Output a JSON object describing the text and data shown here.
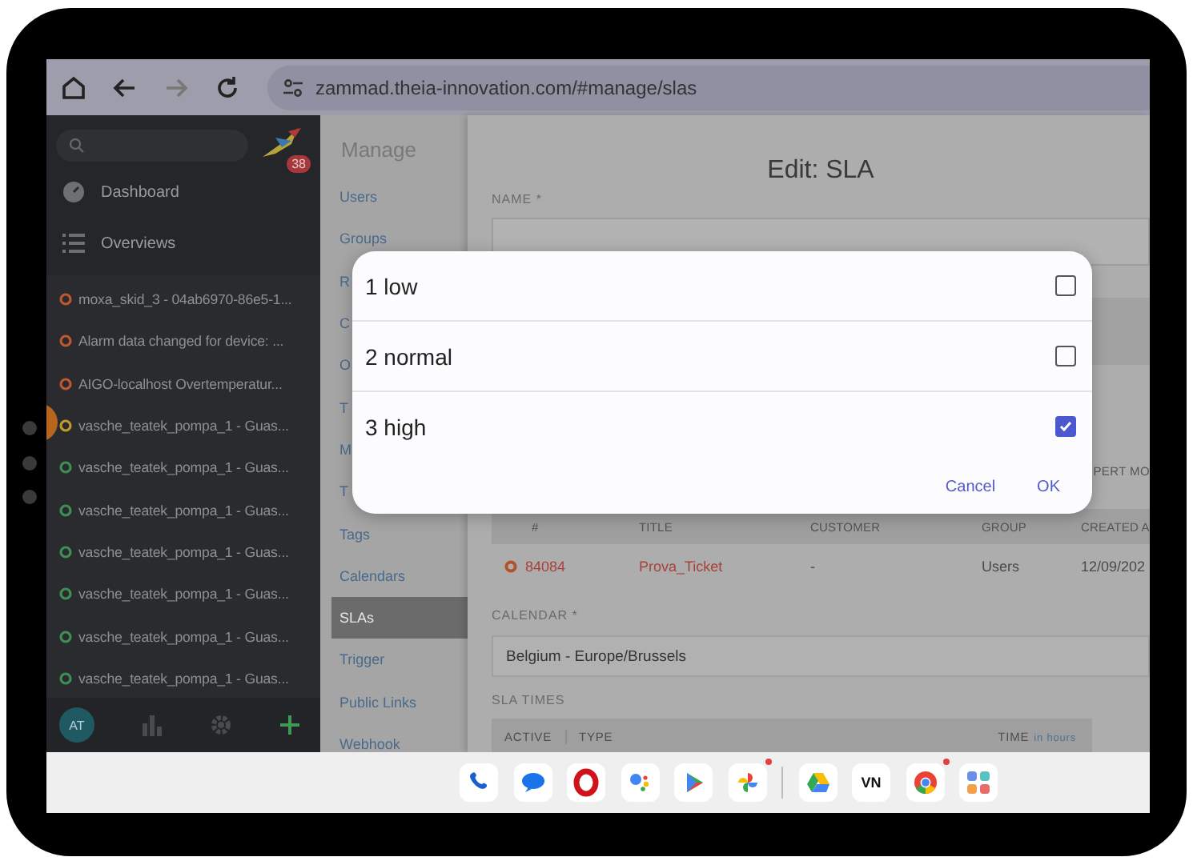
{
  "browser": {
    "url": "zammad.theia-innovation.com/#manage/slas"
  },
  "sidebar": {
    "notification_count": "38",
    "nav": [
      {
        "kind": "dashboard",
        "label": "Dashboard"
      },
      {
        "kind": "overviews",
        "label": "Overviews"
      }
    ],
    "tickets": [
      {
        "title": "moxa_skid_3 - 04ab6970-86e5-1...",
        "color": "#c2562c"
      },
      {
        "title": "Alarm data changed for device: ...",
        "color": "#c2562c"
      },
      {
        "title": "AIGO-localhost Overtemperatur...",
        "color": "#c2562c"
      },
      {
        "title": "vasche_teatek_pompa_1 - Guas...",
        "color": "#c29a2c"
      },
      {
        "title": "vasche_teatek_pompa_1 - Guas...",
        "color": "#3f8f55"
      },
      {
        "title": "vasche_teatek_pompa_1 - Guas...",
        "color": "#3f8f55"
      },
      {
        "title": "vasche_teatek_pompa_1 - Guas...",
        "color": "#3f8f55"
      },
      {
        "title": "vasche_teatek_pompa_1 - Guas...",
        "color": "#3f8f55"
      },
      {
        "title": "vasche_teatek_pompa_1 - Guas...",
        "color": "#3f8f55"
      },
      {
        "title": "vasche_teatek_pompa_1 - Guas...",
        "color": "#3f8f55"
      }
    ],
    "avatar": "AT"
  },
  "manage": {
    "title": "Manage",
    "items": [
      {
        "label": "Users",
        "selected": false
      },
      {
        "label": "Groups",
        "selected": false
      },
      {
        "label": "R",
        "selected": false
      },
      {
        "label": "C",
        "selected": false
      },
      {
        "label": "O",
        "selected": false
      },
      {
        "label": "T",
        "selected": false
      },
      {
        "label": "M",
        "selected": false
      },
      {
        "label": "T",
        "selected": false
      },
      {
        "label": "Tags",
        "selected": false
      },
      {
        "label": "Calendars",
        "selected": false
      },
      {
        "label": "SLAs",
        "selected": true
      },
      {
        "label": "Trigger",
        "selected": false
      },
      {
        "label": "Public Links",
        "selected": false
      },
      {
        "label": "Webhook",
        "selected": false
      }
    ]
  },
  "editor": {
    "title": "Edit: SLA",
    "name_label": "NAME *",
    "expert_label": "PERT MO",
    "tickets_table": {
      "columns": [
        "#",
        "TITLE",
        "CUSTOMER",
        "GROUP",
        "CREATED A"
      ],
      "rows": [
        {
          "number": "84084",
          "title": "Prova_Ticket",
          "customer": "-",
          "group": "Users",
          "created": "12/09/202"
        }
      ]
    },
    "calendar_label": "CALENDAR *",
    "calendar_value": "Belgium - Europe/Brussels",
    "sla_times_label": "SLA TIMES",
    "sla_columns": [
      "ACTIVE",
      "TYPE",
      "TIME"
    ],
    "time_unit": "in hours"
  },
  "dialog": {
    "options": [
      {
        "label": "1 low",
        "checked": false
      },
      {
        "label": "2 normal",
        "checked": false
      },
      {
        "label": "3 high",
        "checked": true
      }
    ],
    "buttons": [
      "Cancel",
      "OK"
    ]
  },
  "dock": {
    "items": [
      {
        "kind": "phone",
        "notification": false
      },
      {
        "kind": "messages",
        "notification": false
      },
      {
        "kind": "opera",
        "notification": false
      },
      {
        "kind": "assistant",
        "notification": false
      },
      {
        "kind": "play",
        "notification": false
      },
      {
        "kind": "photos",
        "notification": true
      },
      {
        "kind": "divider"
      },
      {
        "kind": "drive",
        "notification": false
      },
      {
        "kind": "text",
        "label": "VN",
        "notification": false
      },
      {
        "kind": "chrome",
        "notification": true
      },
      {
        "kind": "apps",
        "notification": false
      }
    ]
  }
}
